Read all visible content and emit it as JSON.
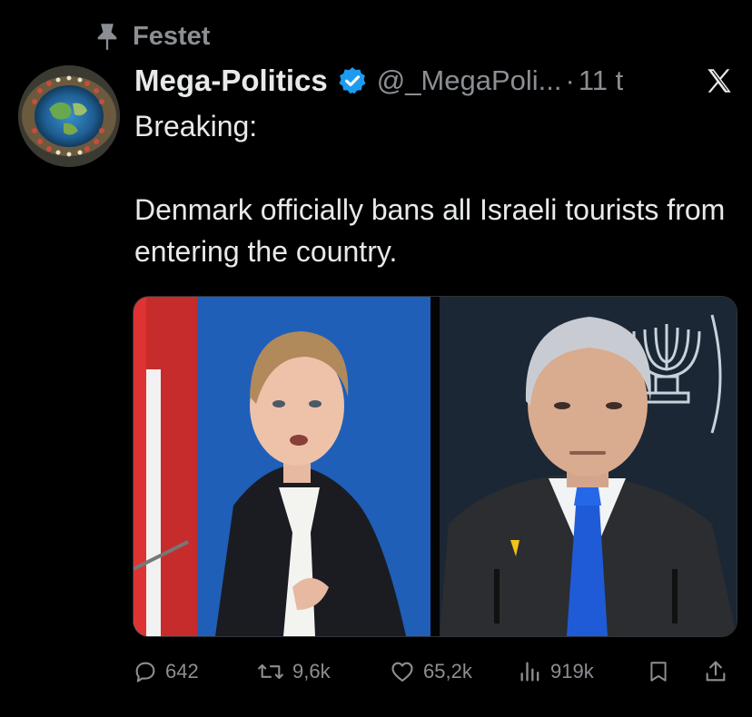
{
  "pinned": {
    "label": "Festet"
  },
  "author": {
    "name": "Mega-Politics",
    "handle": "@_MegaPoli...",
    "separator": "·",
    "time": "11 t",
    "verified": true
  },
  "tweet": {
    "line1": "Breaking:",
    "line2": "Denmark officially bans all Israeli tourists from entering the country."
  },
  "icons": {
    "pin": "pin-icon",
    "verified": "verified-badge-icon",
    "brand": "x-logo-icon",
    "reply": "reply-icon",
    "retweet": "retweet-icon",
    "like": "heart-icon",
    "views": "views-icon",
    "bookmark": "bookmark-icon",
    "share": "share-icon"
  },
  "colors": {
    "background": "#000000",
    "text": "#e7e9ea",
    "muted": "#8b8f94",
    "verified": "#1d9bf0"
  },
  "stats": {
    "replies": "642",
    "retweets": "9,6k",
    "likes": "65,2k",
    "views": "919k"
  }
}
